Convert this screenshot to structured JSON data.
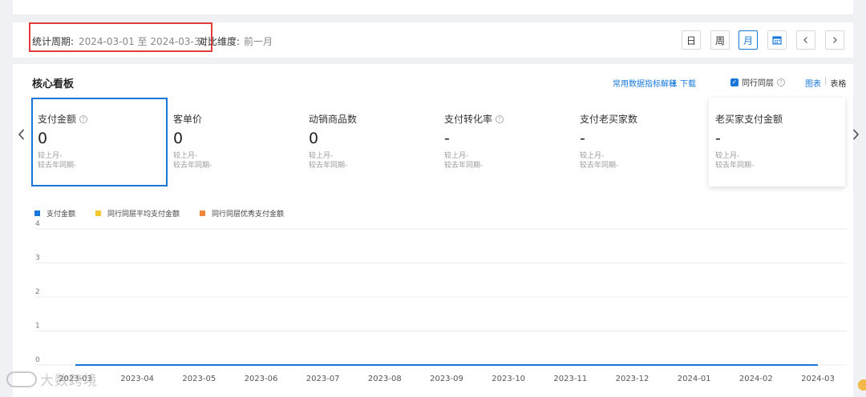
{
  "period": {
    "label": "统计周期:",
    "value": "2024-03-01 至 2024-03-31",
    "compare_label": "对比维度:",
    "compare_value": "前一月"
  },
  "range_buttons": {
    "day": "日",
    "week": "周",
    "month": "月"
  },
  "range_active": "month",
  "panel": {
    "title": "核心看板",
    "explain_link": "常用数据指标解释",
    "download_link": "下载",
    "peer_label": "同行同层",
    "view_chart": "图表",
    "view_sep": "|",
    "view_table": "表格"
  },
  "cards": [
    {
      "label": "支付金额",
      "value": "0",
      "mom": "较上月-",
      "yoy": "较去年同期-"
    },
    {
      "label": "客单价",
      "value": "0",
      "mom": "较上月-",
      "yoy": "较去年同期-"
    },
    {
      "label": "动销商品数",
      "value": "0",
      "mom": "较上月-",
      "yoy": "较去年同期-"
    },
    {
      "label": "支付转化率",
      "value": "-",
      "mom": "较上月-",
      "yoy": "较去年同期-"
    },
    {
      "label": "支付老买家数",
      "value": "-",
      "mom": "较上月-",
      "yoy": "较去年同期-"
    },
    {
      "label": "老买家支付金额",
      "value": "-",
      "mom": "较上月-",
      "yoy": "较去年同期-"
    }
  ],
  "colors": {
    "accent": "#1677d9",
    "series_own": "#1677d9",
    "series_avg": "#f2c830",
    "series_top": "#f0863a",
    "highlight": "#e23b3b"
  },
  "chart_data": {
    "type": "line",
    "x": [
      "2023-03",
      "2023-04",
      "2023-05",
      "2023-06",
      "2023-07",
      "2023-08",
      "2023-09",
      "2023-10",
      "2023-11",
      "2023-12",
      "2024-01",
      "2024-02",
      "2024-03"
    ],
    "yticks": [
      "0",
      "1",
      "2",
      "3",
      "4"
    ],
    "ylim": [
      0,
      4
    ],
    "grid": true,
    "legend_position": "top-left",
    "series": [
      {
        "name": "支付金额",
        "values": [
          0,
          0,
          0,
          0,
          0,
          0,
          0,
          0,
          0,
          0,
          0,
          0,
          0
        ]
      },
      {
        "name": "同行同层平均支付金额",
        "values": []
      },
      {
        "name": "同行同层优秀支付金额",
        "values": []
      }
    ]
  },
  "watermark": "大数跨境"
}
